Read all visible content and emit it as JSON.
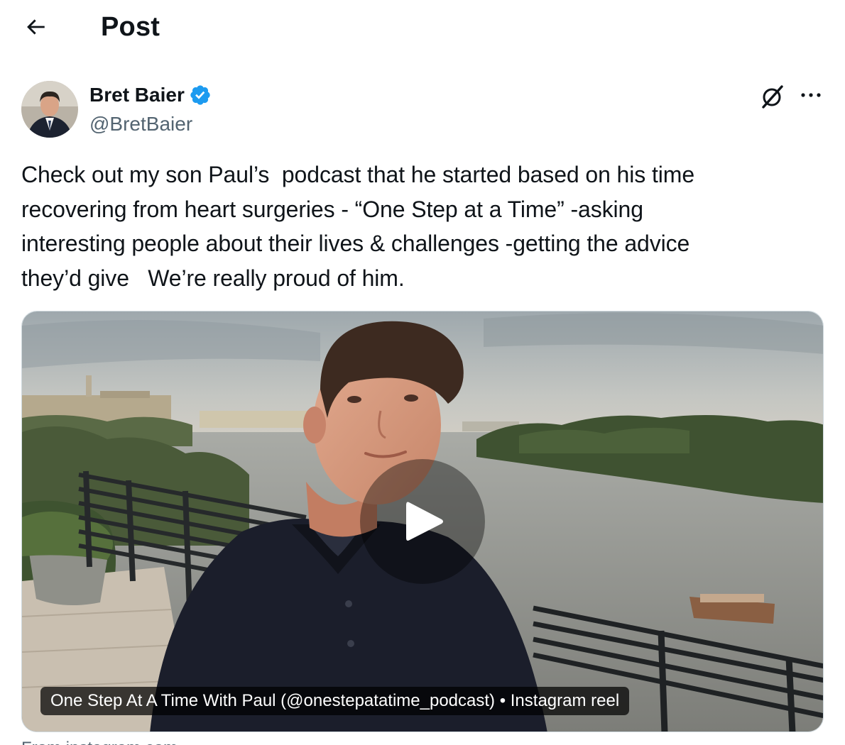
{
  "header": {
    "title": "Post"
  },
  "author": {
    "name": "Bret Baier",
    "handle": "@BretBaier",
    "verified": true
  },
  "tweet": {
    "text": "Check out my son Paul’s  podcast that he started based on his time\nrecovering from heart surgeries - “One Step at a Time” -asking\ninteresting people about their lives & challenges -getting the advice\nthey’d give   We’re really proud of him."
  },
  "media": {
    "caption": "One Step At A Time With Paul (@onestepatatime_podcast) • Instagram reel"
  },
  "footer": {
    "from_label": "From instagram.com"
  },
  "icons": {
    "back": "arrow-left-icon",
    "verified": "verified-badge-icon",
    "grok": "grok-icon",
    "more": "more-icon",
    "play": "play-icon"
  },
  "colors": {
    "verified": "#1d9bf0",
    "secondary_text": "#536471",
    "border": "#cfd9de"
  }
}
